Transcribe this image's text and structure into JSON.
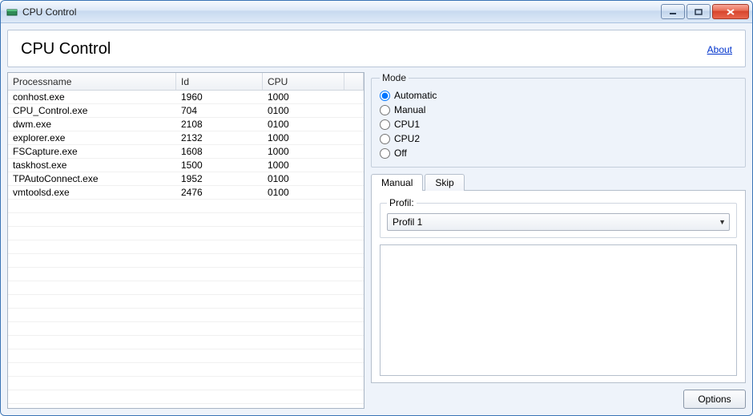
{
  "window": {
    "title": "CPU Control"
  },
  "header": {
    "title": "CPU Control",
    "about": "About"
  },
  "table": {
    "columns": {
      "name": "Processname",
      "id": "Id",
      "cpu": "CPU"
    },
    "rows": [
      {
        "name": "conhost.exe",
        "id": "1960",
        "cpu": "1000"
      },
      {
        "name": "CPU_Control.exe",
        "id": "704",
        "cpu": "0100"
      },
      {
        "name": "dwm.exe",
        "id": "2108",
        "cpu": "0100"
      },
      {
        "name": "explorer.exe",
        "id": "2132",
        "cpu": "1000"
      },
      {
        "name": "FSCapture.exe",
        "id": "1608",
        "cpu": "1000"
      },
      {
        "name": "taskhost.exe",
        "id": "1500",
        "cpu": "1000"
      },
      {
        "name": "TPAutoConnect.exe",
        "id": "1952",
        "cpu": "0100"
      },
      {
        "name": "vmtoolsd.exe",
        "id": "2476",
        "cpu": "0100"
      }
    ]
  },
  "mode": {
    "legend": "Mode",
    "options": {
      "automatic": "Automatic",
      "manual": "Manual",
      "cpu1": "CPU1",
      "cpu2": "CPU2",
      "off": "Off"
    },
    "selected": "automatic"
  },
  "tabs": {
    "manual": "Manual",
    "skip": "Skip"
  },
  "profil": {
    "legend": "Profil:",
    "selected": "Profil 1"
  },
  "buttons": {
    "options": "Options"
  }
}
